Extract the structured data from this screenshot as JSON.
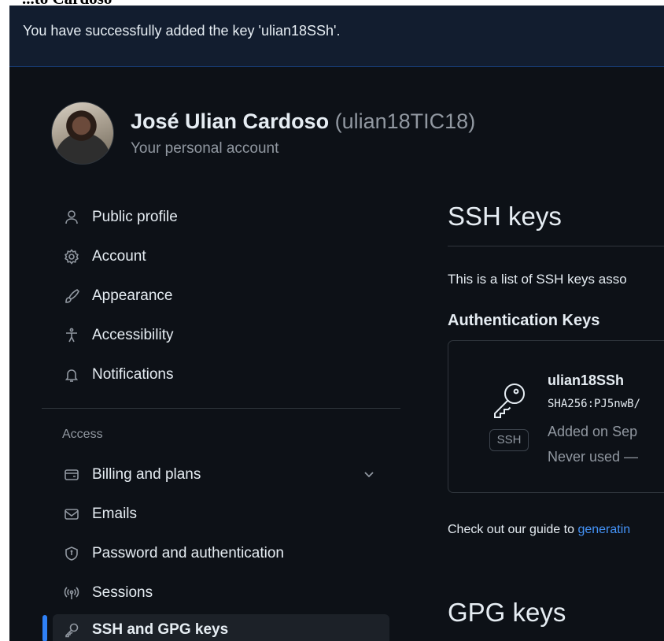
{
  "page_fragment": "...to Cardoso",
  "flash": {
    "message": "You have successfully added the key 'ulian18SSh'."
  },
  "account": {
    "name": "José Ulian Cardoso",
    "handle": "(ulian18TIC18)",
    "subtitle": "Your personal account"
  },
  "sidebar": {
    "items": [
      {
        "label": "Public profile",
        "icon": "person-icon"
      },
      {
        "label": "Account",
        "icon": "gear-icon"
      },
      {
        "label": "Appearance",
        "icon": "paintbrush-icon"
      },
      {
        "label": "Accessibility",
        "icon": "accessibility-icon"
      },
      {
        "label": "Notifications",
        "icon": "bell-icon"
      }
    ],
    "access_label": "Access",
    "access_items": [
      {
        "label": "Billing and plans",
        "icon": "credit-card-icon"
      },
      {
        "label": "Emails",
        "icon": "mail-icon"
      },
      {
        "label": "Password and authentication",
        "icon": "shield-icon"
      },
      {
        "label": "Sessions",
        "icon": "broadcast-icon"
      },
      {
        "label": "SSH and GPG keys",
        "icon": "key-icon",
        "active": true
      }
    ]
  },
  "main": {
    "ssh_heading": "SSH keys",
    "intro": "This is a list of SSH keys asso",
    "auth_heading": "Authentication Keys",
    "key": {
      "title": "ulian18SSh",
      "fingerprint": "SHA256:PJ5nwB/",
      "badge": "SSH",
      "added": "Added on Sep",
      "used": "Never used —"
    },
    "guide_prefix": "Check out our guide to ",
    "guide_link": "generatin",
    "gpg_heading": "GPG keys"
  },
  "colors": {
    "background": "#0d1117",
    "flash_bg": "#121d2f",
    "accent": "#2f81f7",
    "link": "#4493f8"
  }
}
